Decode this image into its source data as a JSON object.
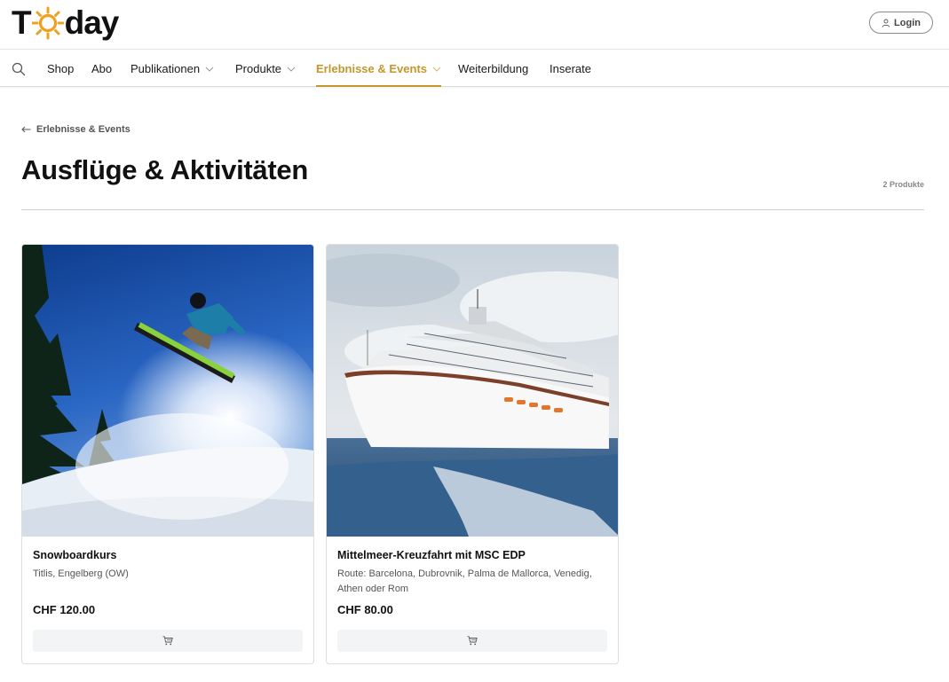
{
  "brand": {
    "logo_prefix": "T",
    "logo_suffix": "day",
    "accent": "#c5962b",
    "sun_color": "#f0a020"
  },
  "header": {
    "login_label": "Login"
  },
  "nav": {
    "items": [
      {
        "label": "Shop",
        "has_dropdown": false
      },
      {
        "label": "Abo",
        "has_dropdown": false
      },
      {
        "label": "Publikationen",
        "has_dropdown": true
      },
      {
        "label": "Produkte",
        "has_dropdown": true
      },
      {
        "label": "Erlebnisse & Events",
        "has_dropdown": true,
        "active": true
      },
      {
        "label": "Weiterbildung",
        "has_dropdown": false
      },
      {
        "label": "Inserate",
        "has_dropdown": false
      }
    ]
  },
  "page": {
    "back_label": "Erlebnisse & Events",
    "title": "Ausflüge & Aktivitäten",
    "product_count": "2 Produkte"
  },
  "products": [
    {
      "title": "Snowboardkurs",
      "subtitle": "Titlis, Engelberg (OW)",
      "price": "CHF 120.00",
      "image": "snowboarder-jump-photo"
    },
    {
      "title": "Mittelmeer-Kreuzfahrt mit MSC EDP",
      "subtitle": "Route: Barcelona, Dubrovnik, Palma de Mallorca, Venedig, Athen oder Rom",
      "price": "CHF 80.00",
      "image": "cruise-ship-photo"
    }
  ]
}
